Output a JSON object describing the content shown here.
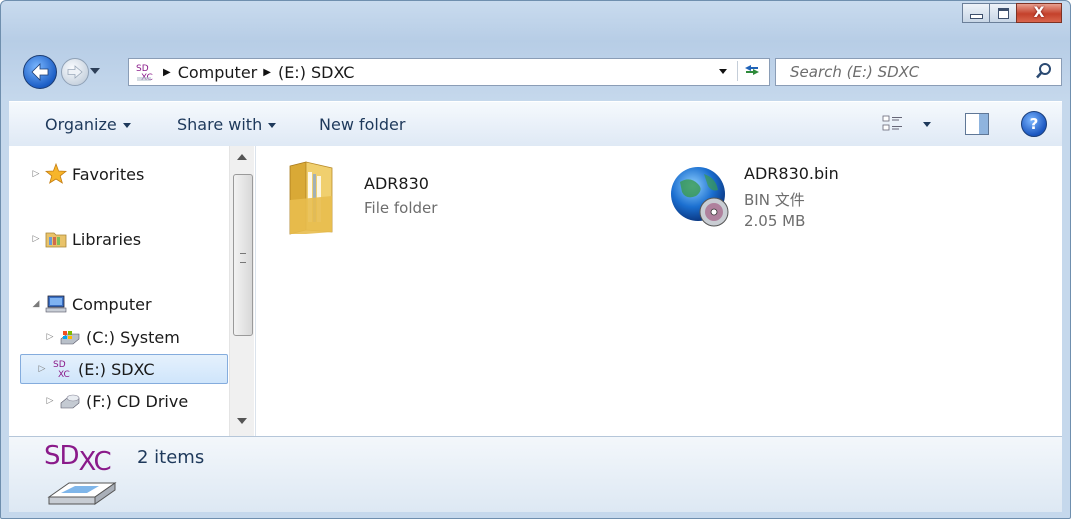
{
  "window": {
    "caption_buttons": {
      "close_glyph": "X"
    }
  },
  "address_bar": {
    "breadcrumbs": [
      "Computer",
      "(E:) SDXC"
    ],
    "location_icon": "sdxc-drive-icon"
  },
  "search": {
    "placeholder": "Search (E:) SDXC"
  },
  "command_bar": {
    "organize": "Organize",
    "share_with": "Share with",
    "new_folder": "New folder",
    "help_glyph": "?"
  },
  "navigation": {
    "items": [
      {
        "label": "Favorites",
        "icon": "star-icon",
        "expander": "▷"
      },
      {
        "label": "Libraries",
        "icon": "libraries-icon",
        "expander": "▷"
      },
      {
        "label": "Computer",
        "icon": "computer-icon",
        "expander": "◢"
      },
      {
        "label": "(C:) System",
        "icon": "hard-drive-icon",
        "expander": "▷"
      },
      {
        "label": "(E:) SDXC",
        "icon": "sdxc-drive-icon",
        "expander": "▷",
        "selected": true
      },
      {
        "label": "(F:) CD Drive",
        "icon": "cd-drive-icon",
        "expander": "▷"
      }
    ]
  },
  "content": {
    "items": [
      {
        "name": "ADR830",
        "type": "File folder",
        "icon": "folder-icon"
      },
      {
        "name": "ADR830.bin",
        "type": "BIN 文件",
        "size": "2.05 MB",
        "icon": "globe-disc-icon"
      }
    ]
  },
  "details": {
    "logo_sd": "SD",
    "logo_xc": "XC",
    "count": "2 items"
  },
  "colors": {
    "accent": "#1e395b",
    "selection": "#cfe5fb",
    "sdxc_purple": "#8a1a8a"
  }
}
